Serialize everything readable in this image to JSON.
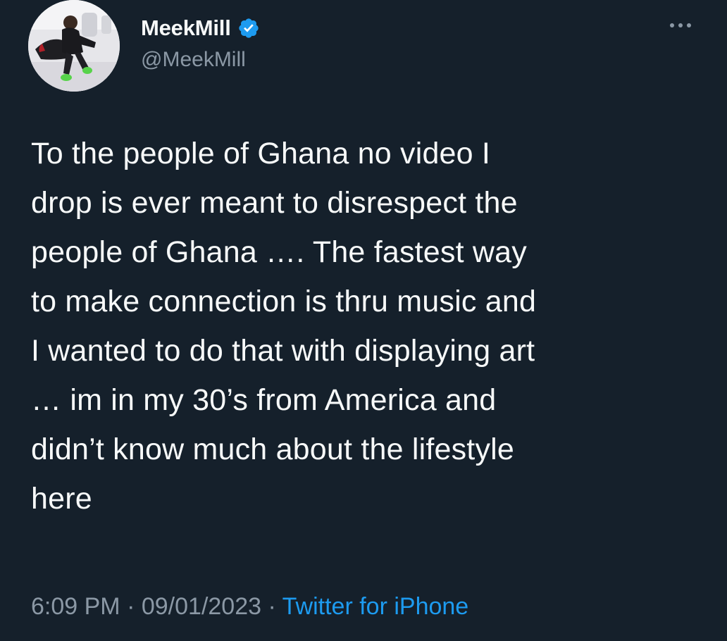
{
  "author": {
    "display_name": "MeekMill",
    "handle": "@MeekMill",
    "verified": true,
    "verified_badge_color": "#1d9bf0"
  },
  "tweet": {
    "text": "To the people of Ghana no video I\ndrop is ever meant to disrespect the\npeople of Ghana …. The fastest way\nto make connection is thru music and\nI wanted to do that with displaying art\n… im in my 30’s from America and\ndidn’t know much about the lifestyle\nhere",
    "time": "6:09 PM",
    "date": "09/01/2023",
    "separator": "·",
    "source": "Twitter for iPhone"
  },
  "icons": {
    "more": "more-horizontal-icon",
    "verified": "verified-badge-icon"
  },
  "colors": {
    "background": "#15202b",
    "text_primary": "#f7f9f9",
    "text_secondary": "#8b98a5",
    "accent": "#1d9bf0"
  }
}
